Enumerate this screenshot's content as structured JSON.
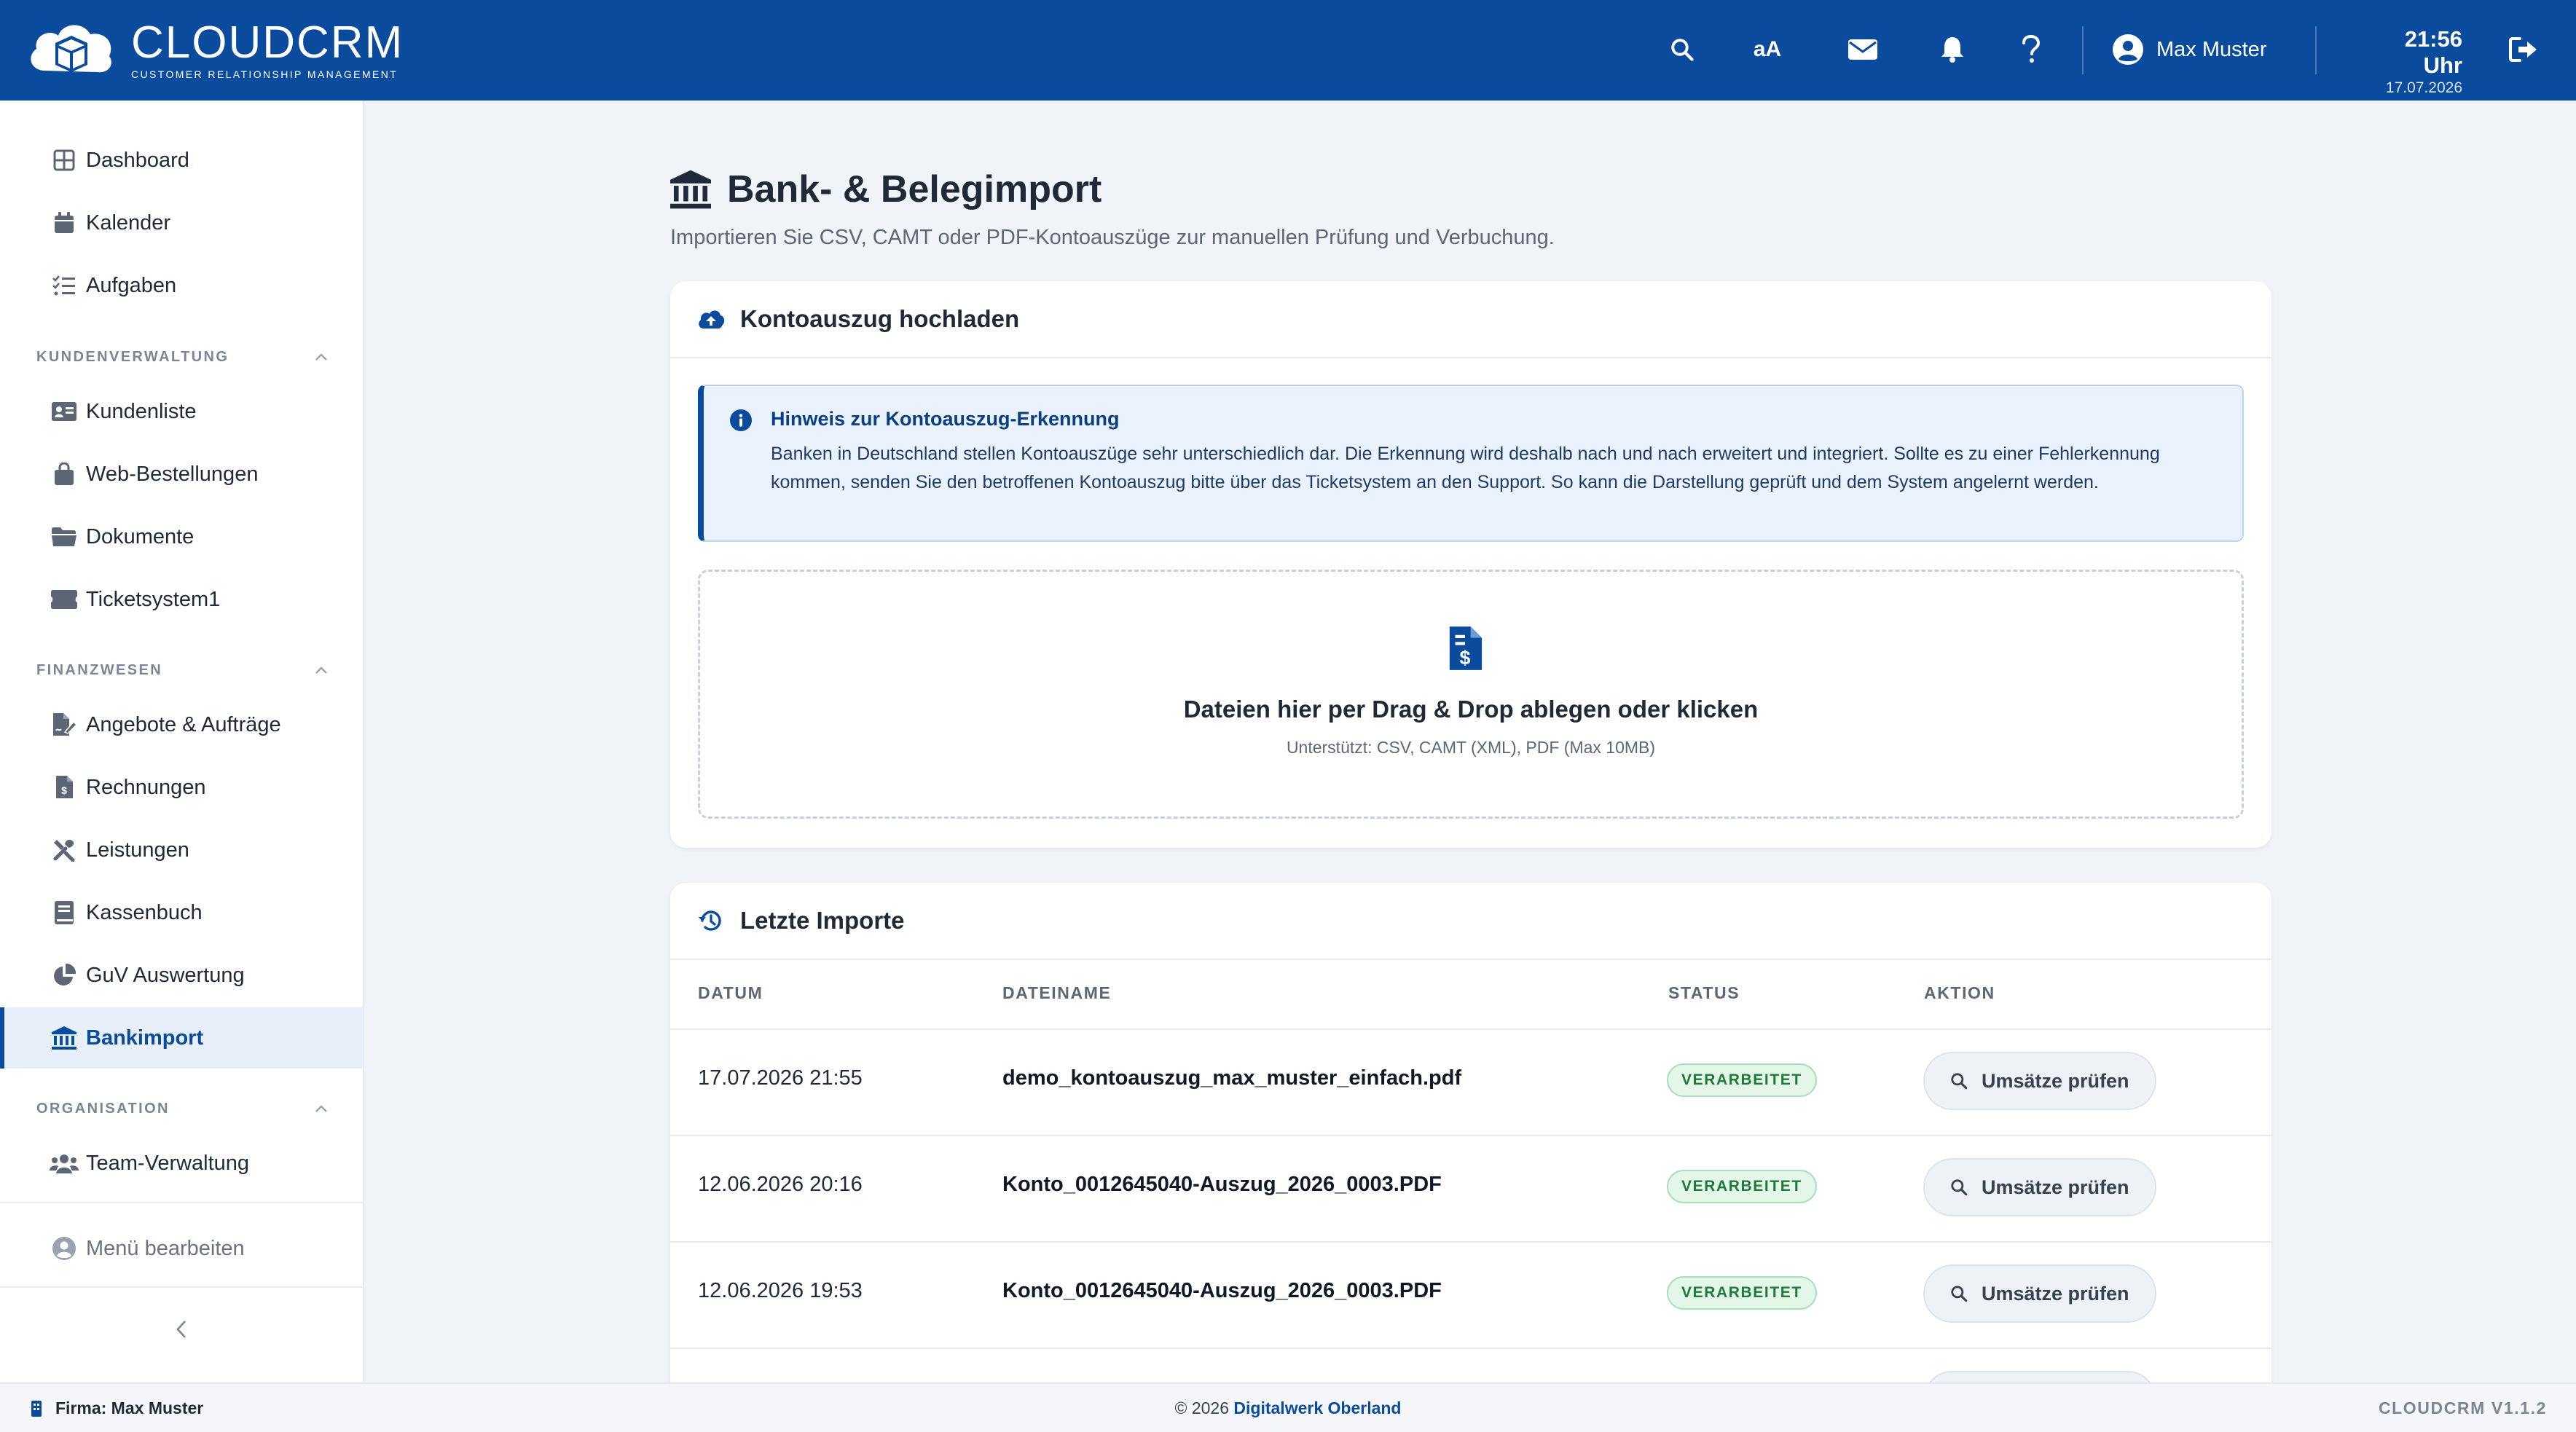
{
  "app": {
    "logo_name": "CLOUDCRM",
    "logo_sub": "CUSTOMER RELATIONSHIP MANAGEMENT"
  },
  "topbar": {
    "font_size_label": "aA",
    "user_name": "Max Muster",
    "time": "21:56 Uhr",
    "date": "17.07.2026"
  },
  "sidebar": {
    "top_items": [
      {
        "label": "Dashboard",
        "icon": "dashboard-icon"
      },
      {
        "label": "Kalender",
        "icon": "calendar-icon"
      },
      {
        "label": "Aufgaben",
        "icon": "tasks-icon"
      }
    ],
    "sections": [
      {
        "title": "KUNDENVERWALTUNG",
        "items": [
          {
            "label": "Kundenliste",
            "icon": "address-card-icon"
          },
          {
            "label": "Web-Bestellungen",
            "icon": "shopping-bag-icon"
          },
          {
            "label": "Dokumente",
            "icon": "folder-icon"
          },
          {
            "label": "Ticketsystem1",
            "icon": "ticket-icon"
          }
        ]
      },
      {
        "title": "FINANZWESEN",
        "items": [
          {
            "label": "Angebote & Aufträge",
            "icon": "file-signature-icon"
          },
          {
            "label": "Rechnungen",
            "icon": "invoice-icon"
          },
          {
            "label": "Leistungen",
            "icon": "tools-icon"
          },
          {
            "label": "Kassenbuch",
            "icon": "book-icon"
          },
          {
            "label": "GuV Auswertung",
            "icon": "pie-chart-icon"
          },
          {
            "label": "Bankimport",
            "icon": "bank-icon",
            "active": true
          }
        ]
      },
      {
        "title": "ORGANISATION",
        "items": [
          {
            "label": "Team-Verwaltung",
            "icon": "users-icon"
          }
        ]
      }
    ],
    "edit_menu_label": "Menü bearbeiten"
  },
  "main": {
    "title": "Bank- & Belegimport",
    "subtitle": "Importieren Sie CSV, CAMT oder PDF-Kontoauszüge zur manuellen Prüfung und Verbuchung.",
    "upload_card": {
      "title": "Kontoauszug hochladen",
      "info_title": "Hinweis zur Kontoauszug-Erkennung",
      "info_text": "Banken in Deutschland stellen Kontoauszüge sehr unterschiedlich dar. Die Erkennung wird deshalb nach und nach erweitert und integriert. Sollte es zu einer Fehlerkennung kommen, senden Sie den betroffenen Kontoauszug bitte über das Ticketsystem an den Support. So kann die Darstellung geprüft und dem System angelernt werden.",
      "dropzone_title": "Dateien hier per Drag & Drop ablegen oder klicken",
      "dropzone_sub": "Unterstützt: CSV, CAMT (XML), PDF (Max 10MB)"
    },
    "imports_card": {
      "title": "Letzte Importe",
      "columns": [
        "DATUM",
        "DATEINAME",
        "STATUS",
        "AKTION"
      ],
      "rows": [
        {
          "date": "17.07.2026 21:55",
          "file": "demo_kontoauszug_max_muster_einfach.pdf",
          "status": "VERARBEITET",
          "action": "Umsätze prüfen"
        },
        {
          "date": "12.06.2026 20:16",
          "file": "Konto_0012645040-Auszug_2026_0003.PDF",
          "status": "VERARBEITET",
          "action": "Umsätze prüfen"
        },
        {
          "date": "12.06.2026 19:53",
          "file": "Konto_0012645040-Auszug_2026_0003.PDF",
          "status": "VERARBEITET",
          "action": "Umsätze prüfen"
        }
      ]
    }
  },
  "footer": {
    "company": "Firma: Max Muster",
    "copyright": "© 2026 ",
    "copyright_link": "Digitalwerk Oberland",
    "version": "CLOUDCRM V1.1.2"
  },
  "colors": {
    "brand": "#0a4b9e",
    "background": "#f0f3f8",
    "success": "#1f7a3a"
  }
}
